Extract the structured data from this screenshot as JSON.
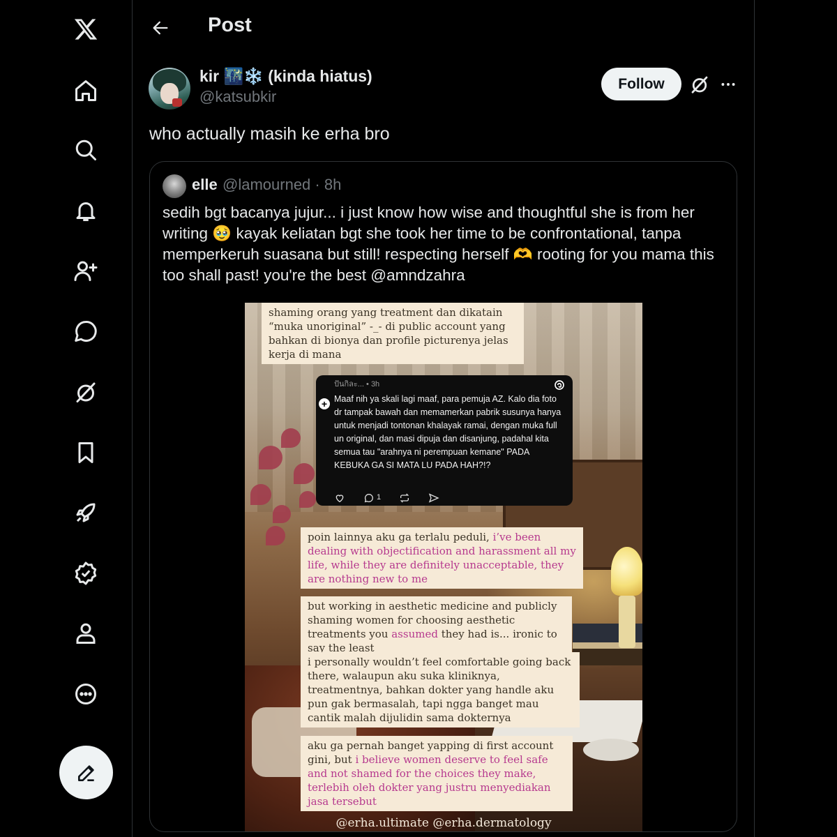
{
  "nav": {
    "items": [
      {
        "name": "x-logo-icon"
      },
      {
        "name": "home-icon"
      },
      {
        "name": "search-icon"
      },
      {
        "name": "notifications-icon"
      },
      {
        "name": "follow-icon"
      },
      {
        "name": "messages-icon"
      },
      {
        "name": "grok-icon"
      },
      {
        "name": "bookmarks-icon"
      },
      {
        "name": "premium-rocket-icon"
      },
      {
        "name": "verified-icon"
      },
      {
        "name": "profile-icon"
      },
      {
        "name": "more-icon"
      }
    ],
    "compose_icon": "compose-icon"
  },
  "header": {
    "title": "Post"
  },
  "post": {
    "author_name": "kir 🌃❄️ (kinda hiatus)",
    "author_handle": "@katsubkir",
    "follow_label": "Follow",
    "text": "who actually masih ke erha bro"
  },
  "quote": {
    "name": "elle",
    "handle_time": "@lamourned · 8h",
    "text": "sedih bgt bacanya jujur... i just know how wise and thoughtful she is from her writing 🥹 kayak keliatan bgt she took her time to be confrontational, tanpa memperkeruh suasana but still! respecting herself 🫶 rooting for you mama this too shall past! you're the best @amndzahra"
  },
  "image": {
    "caption_top": "shaming orang yang treatment dan dikatain “muka unoriginal” -_- di public account yang bahkan di bionya dan profile picturenya jelas kerja di mana",
    "threads": {
      "user": "ปันกิละ... • 3h",
      "body": "Maaf nih ya skali lagi maaf, para pemuja AZ. Kalo dia foto dr tampak bawah dan memamerkan pabrik susunya hanya untuk menjadi tontonan khalayak ramai, dengan muka full un original, dan masi dipuja dan disanjung, padahal kita semua tau \"arahnya ni perempuan kemane\" PADA KEBUKA GA SI MATA LU PADA HAH?!?",
      "reply_count": "1"
    },
    "cap2_plain": "poin lainnya aku ga terlalu peduli,",
    "cap2_pink": " i’ve been dealing with objectification and harassment all my life, while they are definitely unacceptable, they are nothing new to me",
    "cap3_a": "but working in aesthetic medicine and publicly shaming women for choosing aesthetic treatments you",
    "cap3_pink": " assumed",
    "cap3_b": " they had is... ironic to say the least",
    "cap4": "i personally wouldn’t feel comfortable going back there, walaupun aku suka kliniknya, treatmentnya, bahkan dokter yang handle aku pun gak bermasalah, tapi ngga banget mau cantik malah dijulidin sama dokternya",
    "cap5_plain": "aku ga pernah banget yapping di first account gini, but",
    "cap5_pink": " i believe women deserve to feel safe and not shamed for the choices they make, terlebih oleh dokter yang justru menyediakan jasa tersebut",
    "footer": "@erha.ultimate @erha.dermatology"
  },
  "colors": {
    "background": "#000000",
    "text_primary": "#e7e9ea",
    "text_secondary": "#71767b",
    "border": "#2f3336",
    "follow_bg": "#eff3f4",
    "caption_bg": "#f6ead7",
    "caption_pink": "#b6398e"
  }
}
